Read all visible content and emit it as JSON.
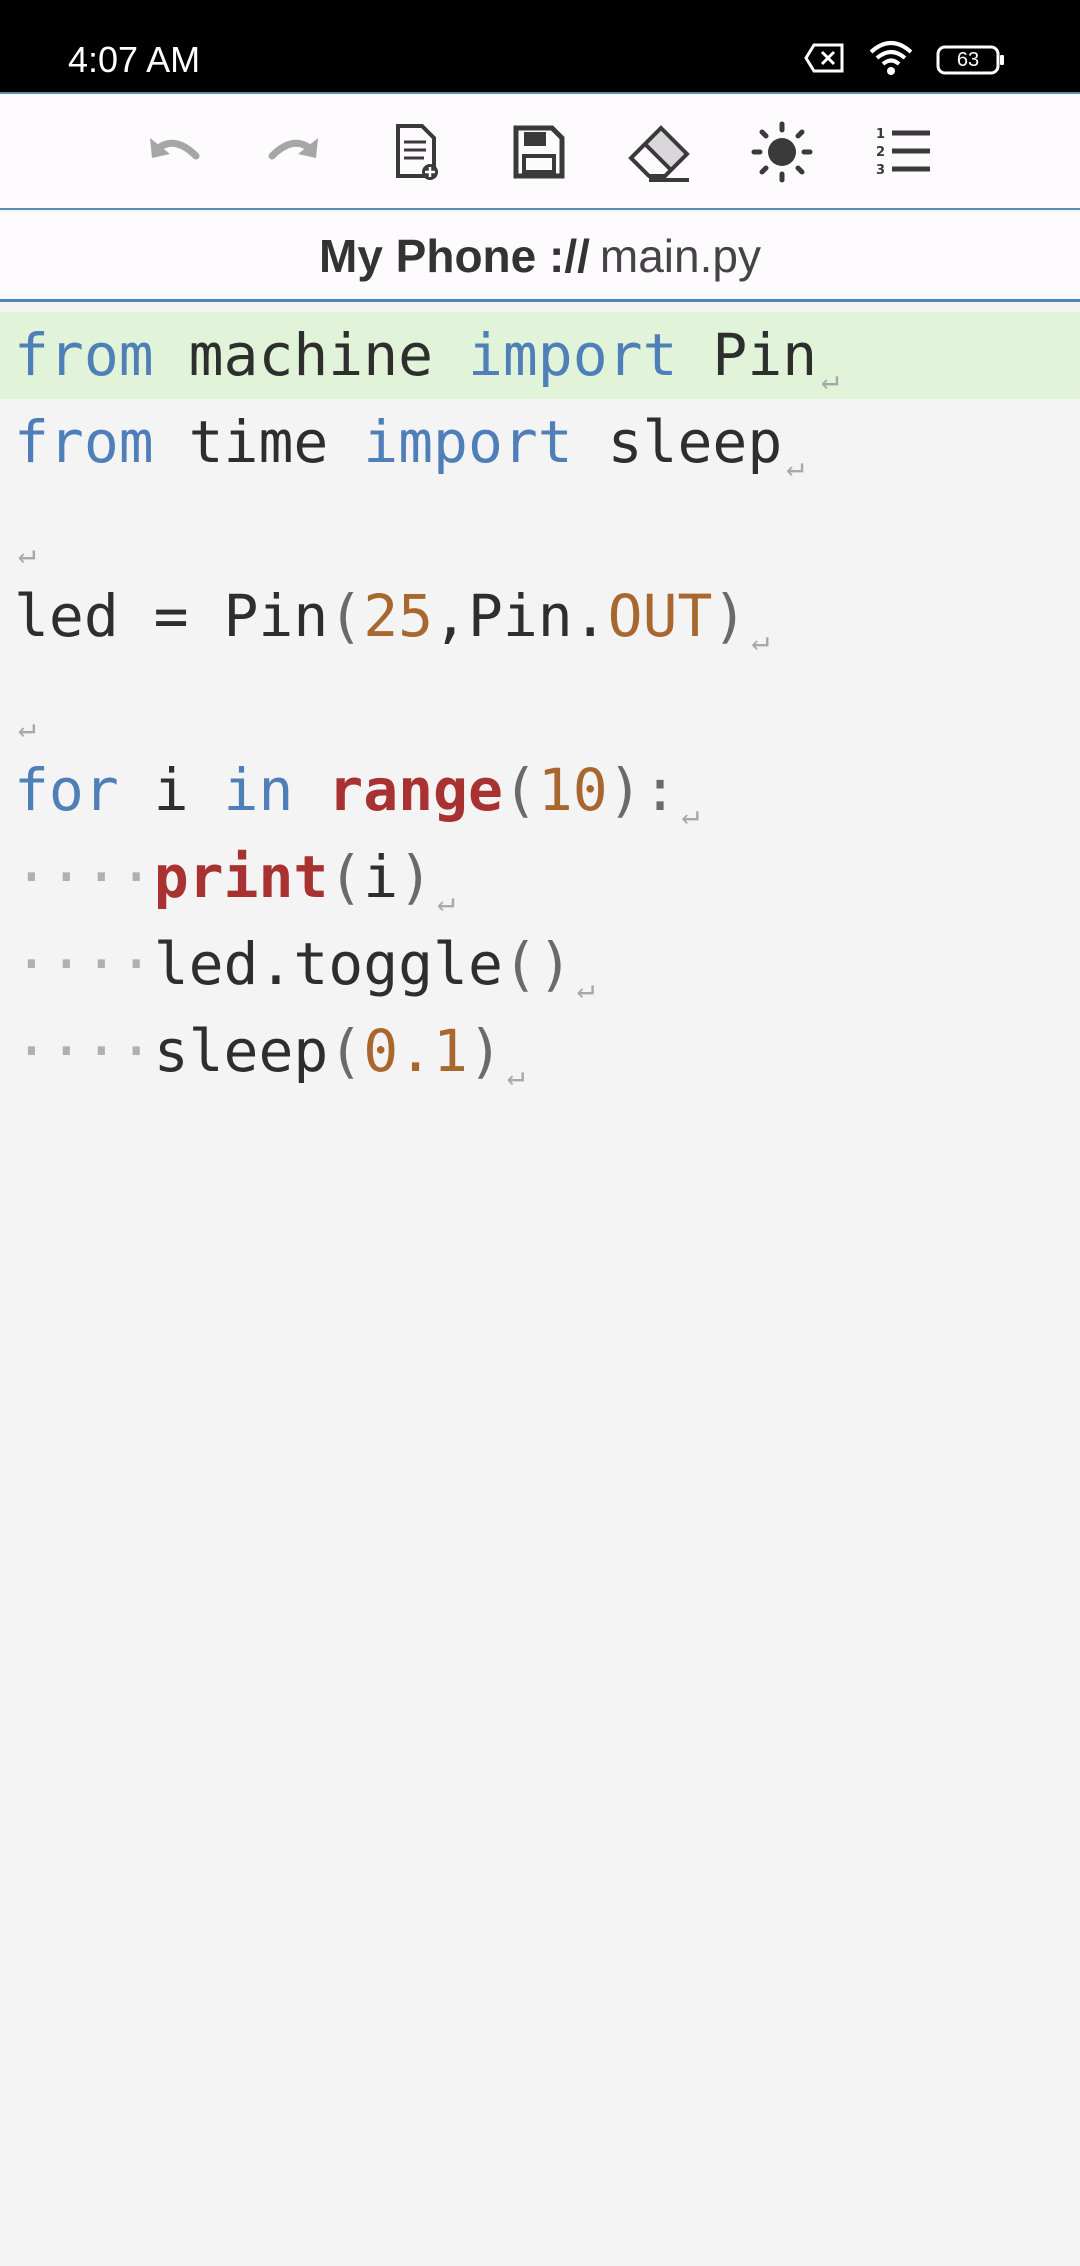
{
  "status_bar": {
    "time": "4:07 AM",
    "battery_level": "63"
  },
  "toolbar": {
    "buttons": [
      {
        "icon": "undo-icon"
      },
      {
        "icon": "redo-icon"
      },
      {
        "icon": "new-file-icon"
      },
      {
        "icon": "save-icon"
      },
      {
        "icon": "eraser-icon"
      },
      {
        "icon": "brightness-icon"
      },
      {
        "icon": "numbered-list-icon"
      }
    ]
  },
  "file_title": {
    "location": "My Phone ://",
    "filename": "main.py"
  },
  "editor": {
    "active_line": 1,
    "colors": {
      "keyword": "#4f7fb8",
      "builtin": "#a83232",
      "number": "#a8672e",
      "active_line_bg": "#e1f3d8"
    },
    "lines": [
      {
        "t1": "from",
        "t2": " machine ",
        "t3": "import",
        "t4": " Pin"
      },
      {
        "t1": "from",
        "t2": " time ",
        "t3": "import",
        "t4": " sleep"
      },
      {},
      {
        "t1": "led = Pin",
        "t2": "(",
        "t3": "25",
        "t4": ",Pin.",
        "t5": "OUT",
        "t6": ")"
      },
      {},
      {
        "t1": "for",
        "t2": " i ",
        "t3": "in",
        "t4": " ",
        "t5": "range",
        "t6": "(",
        "t7": "10",
        "t8": "):"
      },
      {
        "ws": "····",
        "t1": "print",
        "t2": "(",
        "t3": "i",
        "t4": ")"
      },
      {
        "ws": "····",
        "t1": "led.toggle",
        "t2": "()"
      },
      {
        "ws": "····",
        "t1": "sleep",
        "t2": "(",
        "t3": "0.1",
        "t4": ")"
      }
    ],
    "eol_mark": "↵"
  }
}
